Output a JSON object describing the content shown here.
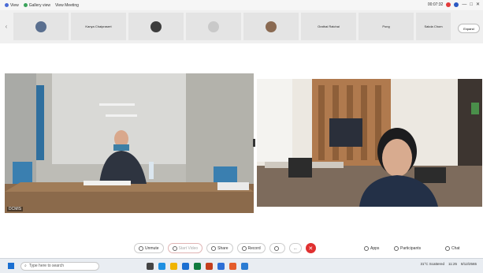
{
  "titlebar": {
    "items": [
      "View",
      "Gallery view",
      "View Meeting"
    ],
    "timer": "00:07:32",
    "minimize": "—",
    "maximize": "□",
    "close": "✕"
  },
  "strip": {
    "tiles": [
      {
        "label": "",
        "avatar": true
      },
      {
        "label": "Kanya Chaiprasert",
        "avatar": false
      },
      {
        "label": "",
        "avatar": true
      },
      {
        "label": "",
        "avatar": true
      },
      {
        "label": "",
        "avatar": true
      },
      {
        "label": "Orathai Ratchai",
        "avatar": false
      },
      {
        "label": "Pong",
        "avatar": false
      },
      {
        "label": "Sakda Chom",
        "avatar": false
      }
    ],
    "expand_label": "Expand",
    "left_arrow": "‹",
    "right_arrow": "›"
  },
  "videos": {
    "main_name": "DCMIS",
    "second_name": ""
  },
  "controls": {
    "unmute": "Unmute",
    "start_video": "Start Video",
    "share": "Share",
    "record": "Record",
    "reactions": "",
    "more": "...",
    "end_icon": "✕",
    "apps": "Apps",
    "participants": "Participants",
    "chat": "Chat"
  },
  "taskbar": {
    "search_placeholder": "Type here to search",
    "weather": "31°C Scattered",
    "time": "11:25",
    "date": "8/12/2565"
  }
}
